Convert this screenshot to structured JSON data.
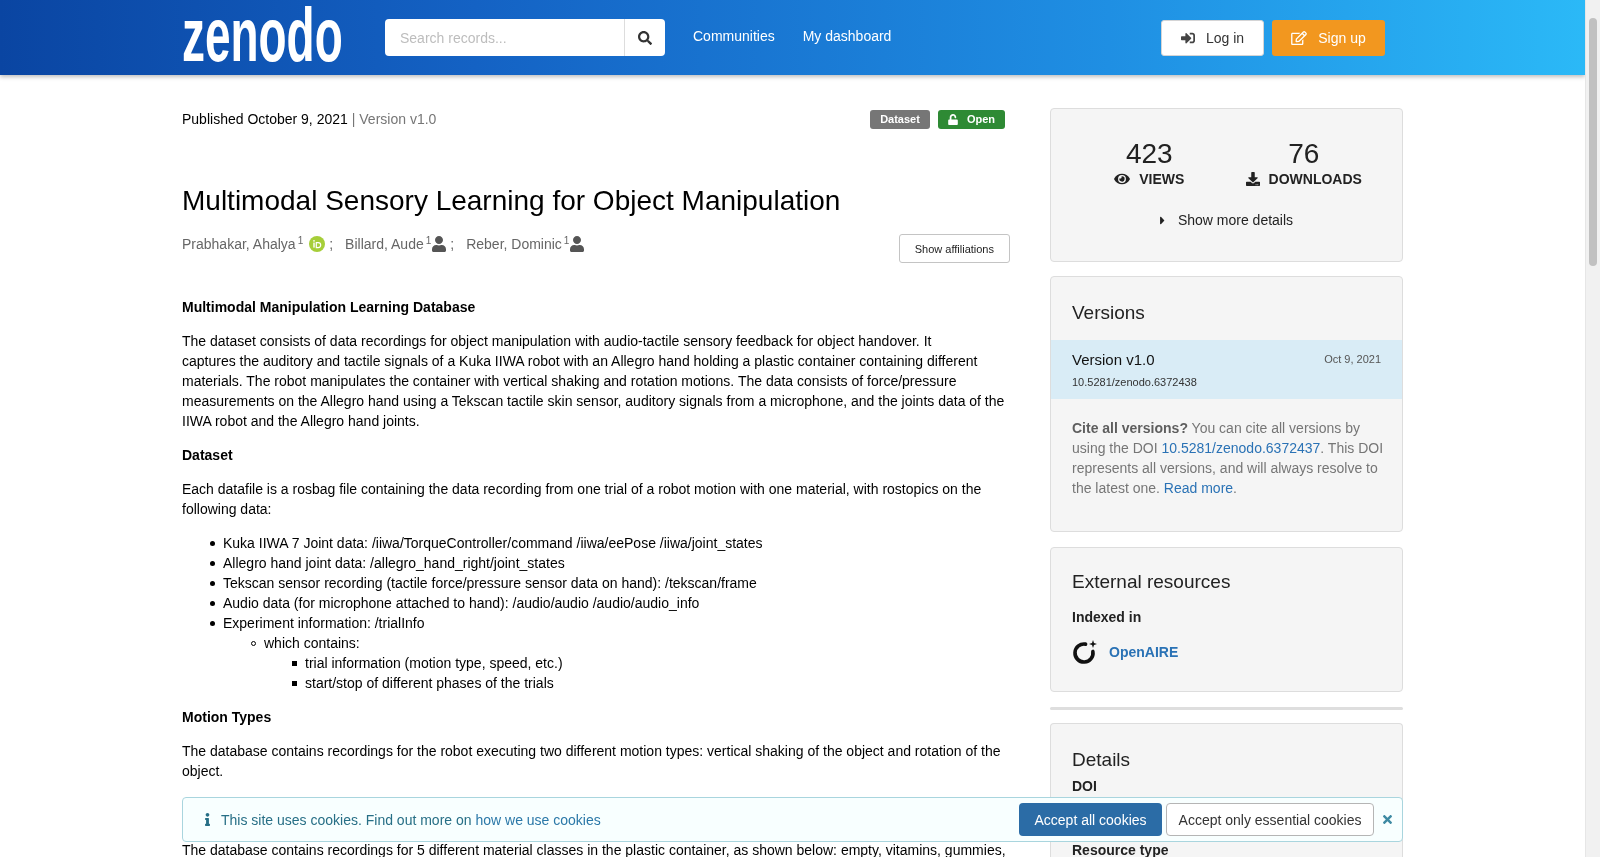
{
  "header": {
    "logo": "zenodo",
    "search": {
      "placeholder": "Search records..."
    },
    "nav": [
      {
        "label": "Communities"
      },
      {
        "label": "My dashboard"
      }
    ],
    "login": "Log in",
    "signup": "Sign up"
  },
  "record": {
    "published": "Published October 9, 2021",
    "version": "| Version v1.0",
    "badges": [
      {
        "kind": "type",
        "label": "Dataset"
      },
      {
        "kind": "access",
        "label": "Open"
      }
    ],
    "title": "Multimodal Sensory Learning for Object Manipulation",
    "creators": [
      {
        "name": "Prabhakar, Ahalya$^{1}$",
        "kind": "orcid",
        "separator": ";"
      },
      {
        "name": "Billard, Aude$^{1}$",
        "kind": "person",
        "separator": ";"
      },
      {
        "name": "Reber, Dominic$^{1}$",
        "kind": "person"
      }
    ],
    "show_affiliations": "Show affiliations"
  },
  "description": [
    {
      "kind": "heading",
      "text": "Multimodal Manipulation Learning Database"
    },
    {
      "kind": "paragraph",
      "text": "The dataset consists of data recordings for object manipulation with audio-tactile sensory feedback for object handover. It\ncaptures the auditory and tactile signals of a Kuka IIWA robot with an Allegro hand holding a plastic container containing different materials. The robot manipulates the container with vertical shaking and rotation motions. The data consists of force/pressure measurements on the Allegro hand using a Tekscan tactile skin sensor, auditory signals from a microphone, and the joints data of the IIWA robot and the Allegro hand joints."
    },
    {
      "kind": "heading",
      "text": "Dataset"
    },
    {
      "kind": "paragraph",
      "text": "Each datafile is a rosbag file containing the data recording from one trial of a robot motion with one material, with rostopics on the following data:"
    },
    {
      "kind": "list",
      "items": [
        {
          "text": "Kuka IIWA 7 Joint data: /iiwa/TorqueController/command /iiwa/eePose /iiwa/joint_states"
        },
        {
          "text": "Allegro hand joint data: /allegro_hand_right/joint_states"
        },
        {
          "text": "Tekscan sensor recording (tactile force/pressure sensor data on hand): /tekscan/frame"
        },
        {
          "text": "Audio data (for microphone attached to hand): /audio/audio /audio/audio_info"
        },
        {
          "text": "Experiment information: /trialInfo",
          "children": [
            {
              "text": "which contains:",
              "children": [
                {
                  "text": "trial information (motion type, speed, etc.)"
                },
                {
                  "text": "start/stop of different phases of the trials"
                }
              ]
            }
          ]
        }
      ]
    },
    {
      "kind": "heading",
      "text": "Motion Types"
    },
    {
      "kind": "paragraph",
      "text": "The database contains recordings for the robot executing two different motion types: vertical shaking of the object and rotation of the object."
    },
    {
      "kind": "cut_paragraph",
      "text": "The database contains recordings for 5 different material classes in the plastic container, as shown below: empty, vitamins, gummies,"
    }
  ],
  "sidebar": {
    "stats": {
      "items": [
        {
          "kind": "views",
          "value": "423",
          "label": "VIEWS"
        },
        {
          "kind": "downloads",
          "value": "76",
          "label": "DOWNLOADS"
        }
      ],
      "more": "Show more details"
    },
    "versions": {
      "title": "Versions",
      "items": [
        {
          "label": "Version v1.0",
          "date": "Oct 9, 2021",
          "doi": "10.5281/zenodo.6372438",
          "selected": true
        }
      ],
      "cite": {
        "lead": "**Cite all versions?** You can cite all versions by using the DOI",
        "doi": "10.5281/zenodo.6372437",
        "middle": ". This DOI represents all versions, and will always resolve to the latest one.",
        "read_more": "Read more",
        "end": "."
      }
    },
    "external": {
      "title": "External resources",
      "subtitle": "Indexed in",
      "links": [
        "OpenAIRE"
      ]
    },
    "details": {
      "title": "Details",
      "fields": [
        {
          "label": "DOI"
        },
        {
          "label": "Resource type"
        }
      ]
    }
  },
  "cookie_banner": {
    "message": "This site uses cookies. Find out more on",
    "link": "how we use cookies",
    "accept_all": "Accept all cookies",
    "accept_essential": "Accept only essential cookies"
  }
}
